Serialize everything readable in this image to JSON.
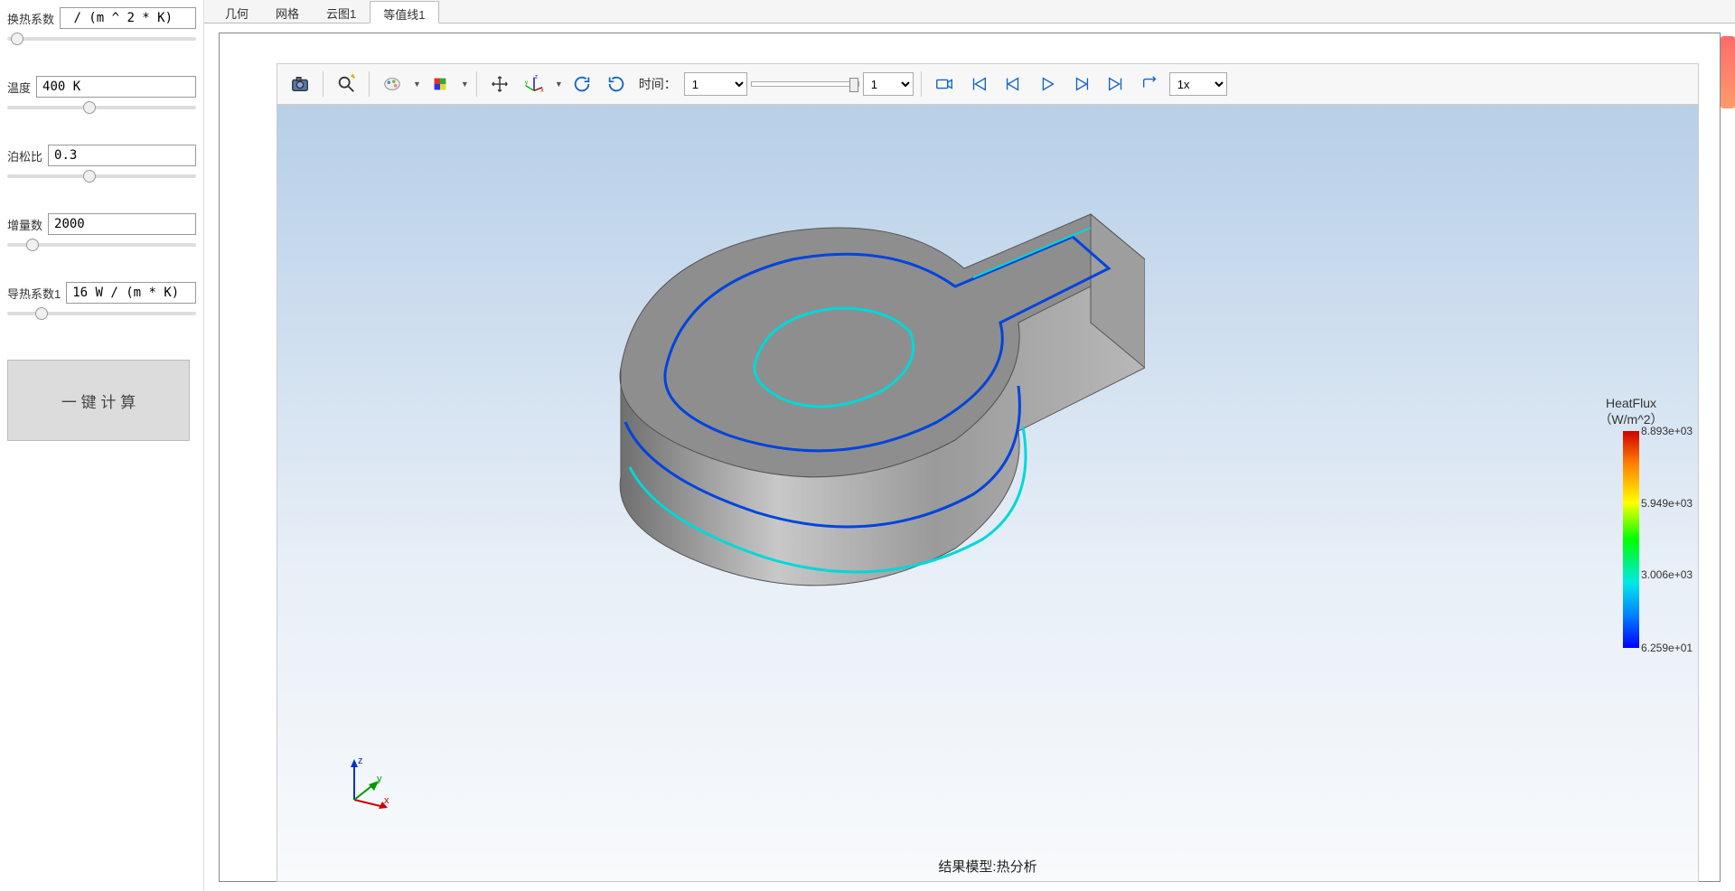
{
  "sidebar": {
    "params": [
      {
        "label": "换热系数",
        "value": " / (m ^ 2 * K)",
        "thumb": 2
      },
      {
        "label": "温度",
        "value": "400 K",
        "thumb": 40
      },
      {
        "label": "泊松比",
        "value": "0.3",
        "thumb": 40
      },
      {
        "label": "增量数",
        "value": "2000",
        "thumb": 10
      },
      {
        "label": "导热系数1",
        "value": "16 W / (m * K)",
        "thumb": 15
      }
    ],
    "calc_button": "一 键 计 算"
  },
  "tabs": {
    "items": [
      "几何",
      "网格",
      "云图1",
      "等值线1"
    ],
    "active": 3
  },
  "toolbar": {
    "time_label": "时间：",
    "time_value": "1",
    "frame_value": "1",
    "speed_value": "1x"
  },
  "viewport": {
    "caption": "结果模型:热分析",
    "axes": {
      "x": "x",
      "y": "y",
      "z": "z"
    }
  },
  "legend": {
    "title1": "HeatFlux",
    "title2": "（W/m^2）",
    "ticks": [
      {
        "label": "8.893e+03",
        "pos": 0
      },
      {
        "label": "5.949e+03",
        "pos": 33
      },
      {
        "label": "3.006e+03",
        "pos": 66
      },
      {
        "label": "6.259e+01",
        "pos": 100
      }
    ]
  }
}
